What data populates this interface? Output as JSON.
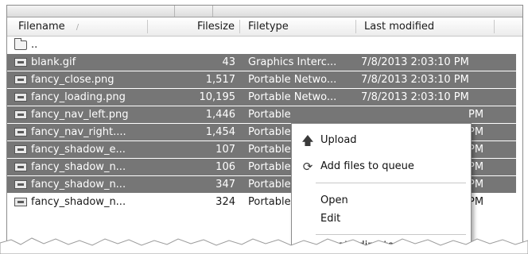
{
  "columns": {
    "filename": "Filename",
    "sort_indicator": "/",
    "filesize": "Filesize",
    "filetype": "Filetype",
    "last_modified": "Last modified"
  },
  "parent_dir": "..",
  "files": [
    {
      "name": "blank.gif",
      "size": "43",
      "type": "Graphics Interc...",
      "modified": "7/8/2013 2:03:10 PM"
    },
    {
      "name": "fancy_close.png",
      "size": "1,517",
      "type": "Portable Netwo...",
      "modified": "7/8/2013 2:03:10 PM"
    },
    {
      "name": "fancy_loading.png",
      "size": "10,195",
      "type": "Portable Netwo...",
      "modified": "7/8/2013 2:03:10 PM"
    },
    {
      "name": "fancy_nav_left.png",
      "size": "1,446",
      "type": "Portable",
      "modified": "PM"
    },
    {
      "name": "fancy_nav_right....",
      "size": "1,454",
      "type": "Portable",
      "modified": "PM"
    },
    {
      "name": "fancy_shadow_e...",
      "size": "107",
      "type": "Portable",
      "modified": "PM"
    },
    {
      "name": "fancy_shadow_n...",
      "size": "106",
      "type": "Portable",
      "modified": "PM"
    },
    {
      "name": "fancy_shadow_n...",
      "size": "347",
      "type": "Portable",
      "modified": "PM"
    },
    {
      "name": "fancy_shadow_n...",
      "size": "324",
      "type": "Portable",
      "modified": "PM"
    }
  ],
  "context_menu": {
    "upload": "Upload",
    "add_to_queue": "Add files to queue",
    "open": "Open",
    "edit": "Edit",
    "create_directory": "Create directory"
  },
  "colors": {
    "selection": "#767676",
    "selection_text": "#ffffff"
  }
}
